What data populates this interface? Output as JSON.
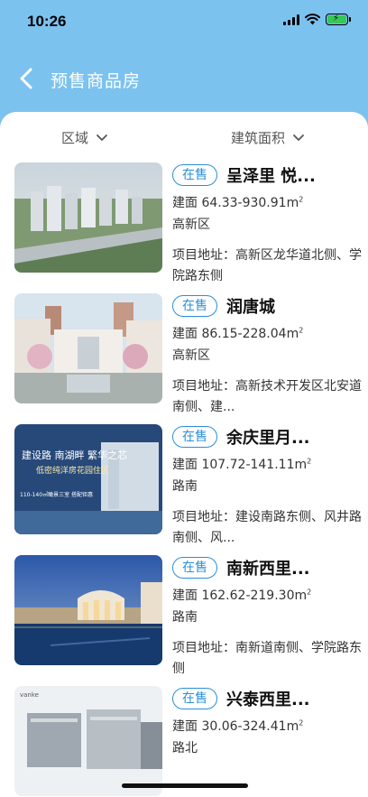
{
  "status_bar": {
    "time": "10:26"
  },
  "header": {
    "title": "预售商品房"
  },
  "filters": {
    "region_label": "区域",
    "area_label": "建筑面积"
  },
  "listings": [
    {
      "badge": "在售",
      "name": "呈泽里 悦...",
      "area_prefix": "建面 ",
      "area_range": "64.33-930.91m",
      "area_unit_sup": "2",
      "district": "高新区",
      "address": "项目地址：高新区龙华道北侧、学院路东侧"
    },
    {
      "badge": "在售",
      "name": "润唐城",
      "area_prefix": "建面 ",
      "area_range": "86.15-228.04m",
      "area_unit_sup": "2",
      "district": "高新区",
      "address": "项目地址：高新技术开发区北安道南侧、建..."
    },
    {
      "badge": "在售",
      "name": "余庆里月...",
      "area_prefix": "建面 ",
      "area_range": "107.72-141.11m",
      "area_unit_sup": "2",
      "district": "路南",
      "address": "项目地址：建设南路东侧、风井路南侧、风..."
    },
    {
      "badge": "在售",
      "name": "南新西里...",
      "area_prefix": "建面 ",
      "area_range": "162.62-219.30m",
      "area_unit_sup": "2",
      "district": "路南",
      "address": "项目地址：南新道南侧、学院路东侧"
    },
    {
      "badge": "在售",
      "name": "兴泰西里...",
      "area_prefix": "建面 ",
      "area_range": "30.06-324.41m",
      "area_unit_sup": "2",
      "district": "路北",
      "address": ""
    }
  ],
  "thumb_texts": {
    "t3_line1": "建设路 南湖畔 繁华之芯",
    "t3_line2": "低密纯洋房花园住区",
    "t3_line3": "110-140㎡瞰景三室 搭配钜惠",
    "t5_brand": "vanke"
  },
  "colors": {
    "accent": "#2a8fd8",
    "header_bg": "#7cc2ef"
  }
}
